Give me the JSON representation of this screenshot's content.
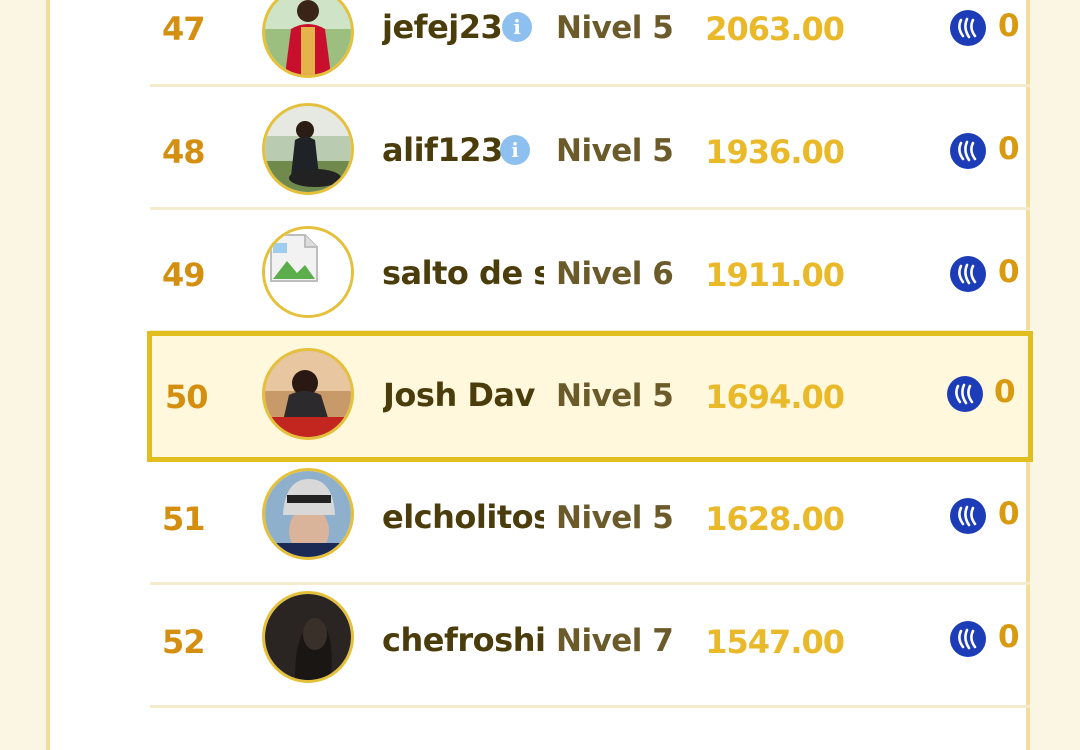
{
  "leaderboard": {
    "rows": [
      {
        "rank": "47",
        "username": "jefej23",
        "level": "Nivel 5",
        "points": "2063.00",
        "reward": "0",
        "avatar": "person-red-outfit"
      },
      {
        "rank": "48",
        "username": "alif123",
        "level": "Nivel 5",
        "points": "1936.00",
        "reward": "0",
        "avatar": "person-on-motorbike"
      },
      {
        "rank": "49",
        "username": "salto de s",
        "level": "Nivel 6",
        "points": "1911.00",
        "reward": "0",
        "avatar": "broken-image-icon"
      },
      {
        "rank": "50",
        "username": "Josh Dav",
        "level": "Nivel 5",
        "points": "1694.00",
        "reward": "0",
        "avatar": "person-seated"
      },
      {
        "rank": "51",
        "username": "elcholitos",
        "level": "Nivel 5",
        "points": "1628.00",
        "reward": "0",
        "avatar": "person-beanie"
      },
      {
        "rank": "52",
        "username": "chefroshi",
        "level": "Nivel 7",
        "points": "1547.00",
        "reward": "0",
        "avatar": "dark-photo"
      }
    ]
  },
  "colors": {
    "rank": "#d48f10",
    "username": "#4b3d0b",
    "level": "#6b5a2a",
    "points": "#eab92a",
    "highlight_border": "#e2bd1e",
    "highlight_bg": "#fff8dc",
    "steem_icon": "#1d3db8",
    "info_icon": "#8ec0ef"
  },
  "icons": {
    "reward_icon": "steem-icon",
    "verified_icon": "info-icon"
  }
}
